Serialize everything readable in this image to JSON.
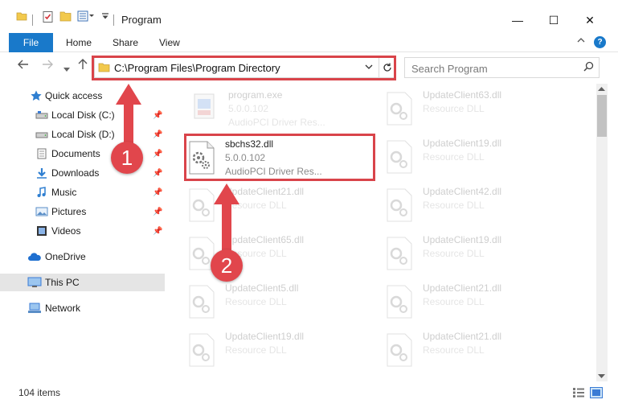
{
  "window": {
    "title": "Program",
    "minimize": "—",
    "maximize": "☐",
    "close": "✕"
  },
  "ribbon": {
    "file": "File",
    "tabs": [
      "Home",
      "Share",
      "View"
    ],
    "help": "?"
  },
  "navigation": {
    "address": "C:\\Program Files\\Program Directory",
    "search_placeholder": "Search Program"
  },
  "sidebar": {
    "items": [
      {
        "label": "Quick access",
        "icon": "star-icon",
        "pinned": false
      },
      {
        "label": "Local Disk (C:)",
        "icon": "drive-icon",
        "pinned": true
      },
      {
        "label": "Local Disk (D:)",
        "icon": "drive-icon",
        "pinned": true
      },
      {
        "label": "Documents",
        "icon": "documents-icon",
        "pinned": true
      },
      {
        "label": "Downloads",
        "icon": "download-icon",
        "pinned": true
      },
      {
        "label": "Music",
        "icon": "music-icon",
        "pinned": true
      },
      {
        "label": "Pictures",
        "icon": "pictures-icon",
        "pinned": true
      },
      {
        "label": "Videos",
        "icon": "video-icon",
        "pinned": true
      },
      {
        "label": "OneDrive",
        "icon": "cloud-icon",
        "pinned": false
      },
      {
        "label": "This PC",
        "icon": "pc-icon",
        "pinned": false,
        "selected": true
      },
      {
        "label": "Network",
        "icon": "network-icon",
        "pinned": false
      }
    ]
  },
  "files": {
    "col1": [
      {
        "name": "program.exe",
        "line2": "5.0.0.102",
        "line3": "AudioPCI Driver Res...",
        "faded": true,
        "type": "exe"
      },
      {
        "name": "sbchs32.dll",
        "line2": "5.0.0.102",
        "line3": "AudioPCI Driver Res...",
        "faded": false,
        "type": "dll"
      },
      {
        "name": "UpdateClient21.dll",
        "line2": "Resource DLL",
        "faded": true,
        "type": "dll"
      },
      {
        "name": "UpdateClient65.dll",
        "line2": "Resource DLL",
        "faded": true,
        "type": "dll"
      },
      {
        "name": "UpdateClient5.dll",
        "line2": "Resource DLL",
        "faded": true,
        "type": "dll"
      },
      {
        "name": "UpdateClient19.dll",
        "line2": "Resource DLL",
        "faded": true,
        "type": "dll"
      }
    ],
    "col2": [
      {
        "name": "UpdateClient63.dll",
        "line2": "Resource DLL",
        "faded": true
      },
      {
        "name": "UpdateClient19.dll",
        "line2": "Resource DLL",
        "faded": true
      },
      {
        "name": "UpdateClient42.dll",
        "line2": "Resource DLL",
        "faded": true
      },
      {
        "name": "UpdateClient19.dll",
        "line2": "Resource DLL",
        "faded": true
      },
      {
        "name": "UpdateClient21.dll",
        "line2": "Resource DLL",
        "faded": true
      },
      {
        "name": "UpdateClient21.dll",
        "line2": "Resource DLL",
        "faded": true
      }
    ]
  },
  "status": {
    "count": "104 items"
  },
  "steps": {
    "step1": "1",
    "step2": "2"
  },
  "colors": {
    "accent": "#1979ca",
    "highlight": "#d9444a",
    "badge": "#e1464c"
  }
}
